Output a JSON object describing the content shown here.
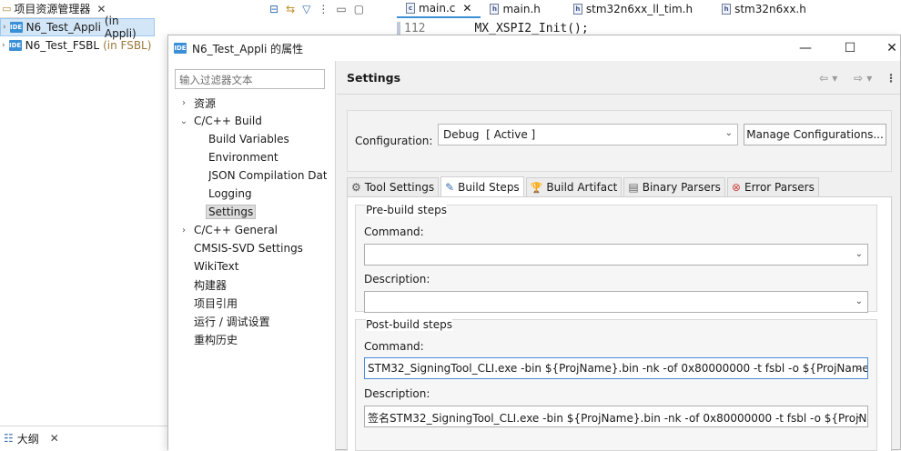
{
  "project_explorer": {
    "tab_label": "项目资源管理器",
    "items": [
      {
        "name": "N6_Test_Appli",
        "suffix": "(in Appli)"
      },
      {
        "name": "N6_Test_FSBL",
        "suffix": "(in FSBL)"
      }
    ],
    "outline_label": "大纲"
  },
  "editor": {
    "tabs": [
      "main.c",
      "main.h",
      "stm32n6xx_ll_tim.h",
      "stm32n6xx.h"
    ],
    "line_number": "112",
    "code": "MX_XSPI2_Init();"
  },
  "dialog": {
    "title": "N6_Test_Appli 的属性",
    "filter_placeholder": "输入过滤器文本",
    "tree": [
      {
        "label": "资源",
        "indent": 0,
        "chevron": "›"
      },
      {
        "label": "C/C++ Build",
        "indent": 0,
        "chevron": "⌄"
      },
      {
        "label": "Build Variables",
        "indent": 1,
        "chevron": ""
      },
      {
        "label": "Environment",
        "indent": 1,
        "chevron": ""
      },
      {
        "label": "JSON Compilation Dat",
        "indent": 1,
        "chevron": ""
      },
      {
        "label": "Logging",
        "indent": 1,
        "chevron": ""
      },
      {
        "label": "Settings",
        "indent": 1,
        "chevron": "",
        "selected": true
      },
      {
        "label": "C/C++ General",
        "indent": 0,
        "chevron": "›"
      },
      {
        "label": "CMSIS-SVD Settings",
        "indent": 0,
        "chevron": ""
      },
      {
        "label": "WikiText",
        "indent": 0,
        "chevron": ""
      },
      {
        "label": "构建器",
        "indent": 0,
        "chevron": ""
      },
      {
        "label": "项目引用",
        "indent": 0,
        "chevron": ""
      },
      {
        "label": "运行 / 调试设置",
        "indent": 0,
        "chevron": ""
      },
      {
        "label": "重构历史",
        "indent": 0,
        "chevron": ""
      }
    ],
    "page_title": "Settings",
    "configuration": {
      "label": "Configuration:",
      "value": "Debug  [ Active ]",
      "manage_button": "Manage Configurations..."
    },
    "tabs": [
      {
        "label": "Tool Settings",
        "icon": "tool-settings-icon",
        "glyph": "⚙"
      },
      {
        "label": "Build Steps",
        "icon": "build-steps-icon",
        "glyph": "✎",
        "active": true
      },
      {
        "label": "Build Artifact",
        "icon": "build-artifact-icon",
        "glyph": "🏆"
      },
      {
        "label": "Binary Parsers",
        "icon": "binary-parsers-icon",
        "glyph": "▤"
      },
      {
        "label": "Error Parsers",
        "icon": "error-parsers-icon",
        "glyph": "⊗"
      }
    ],
    "pre_build": {
      "title": "Pre-build steps",
      "command_label": "Command:",
      "command_value": "",
      "description_label": "Description:",
      "description_value": ""
    },
    "post_build": {
      "title": "Post-build steps",
      "command_label": "Command:",
      "command_value": "STM32_SigningTool_CLI.exe -bin ${ProjName}.bin -nk -of 0x80000000 -t fsbl -o ${ProjName",
      "description_label": "Description:",
      "description_value": "签名STM32_SigningTool_CLI.exe -bin ${ProjName}.bin -nk -of 0x80000000 -t fsbl -o ${ProjN"
    }
  },
  "colors": {
    "accent": "#3b8fd6",
    "selection": "#d3e6f7",
    "error_red": "#d04040"
  }
}
